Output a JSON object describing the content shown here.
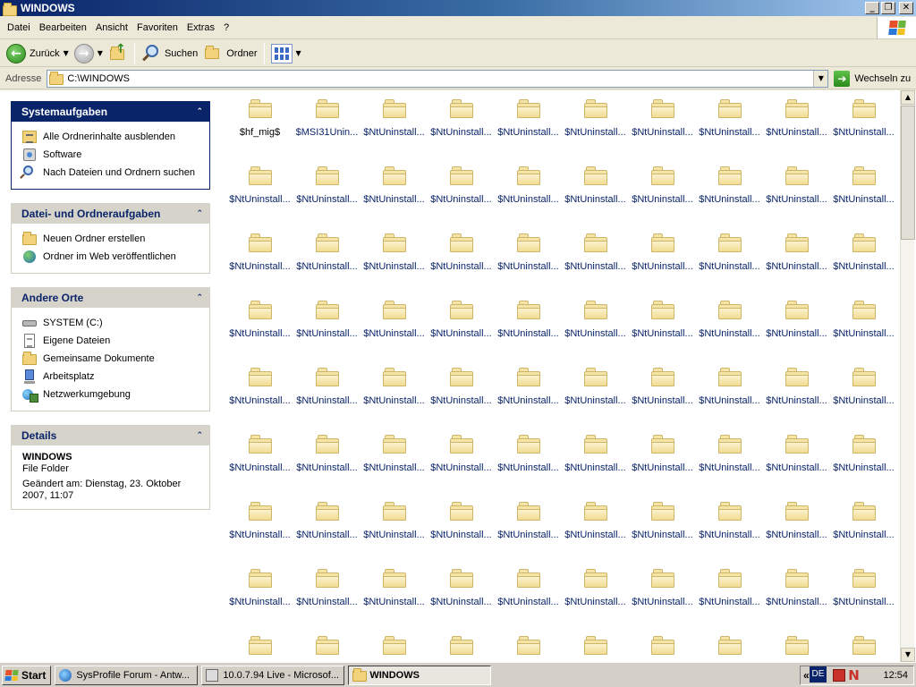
{
  "window": {
    "title": "WINDOWS",
    "controls": {
      "minimize": "_",
      "maximize": "❐",
      "close": "✕"
    }
  },
  "menu": [
    "Datei",
    "Bearbeiten",
    "Ansicht",
    "Favoriten",
    "Extras",
    "?"
  ],
  "toolbar": {
    "back_label": "Zurück",
    "search_label": "Suchen",
    "folders_label": "Ordner"
  },
  "address": {
    "label": "Adresse",
    "value": "C:\\WINDOWS",
    "go_label": "Wechseln zu"
  },
  "taskpane": {
    "system_tasks": {
      "title": "Systemaufgaben",
      "items": [
        "Alle Ordnerinhalte ausblenden",
        "Software",
        "Nach Dateien und Ordnern suchen"
      ]
    },
    "file_tasks": {
      "title": "Datei- und Ordneraufgaben",
      "items": [
        "Neuen Ordner erstellen",
        "Ordner im Web veröffentlichen"
      ]
    },
    "other_places": {
      "title": "Andere Orte",
      "items": [
        "SYSTEM (C:)",
        "Eigene Dateien",
        "Gemeinsame Dokumente",
        "Arbeitsplatz",
        "Netzwerkumgebung"
      ]
    },
    "details": {
      "title": "Details",
      "name": "WINDOWS",
      "type": "File Folder",
      "modified": "Geändert am: Dienstag, 23. Oktober 2007, 11:07"
    }
  },
  "files": {
    "first": [
      "$hf_mig$",
      "$MSI31Unin..."
    ],
    "repeated_name": "$NtUninstall...",
    "repeated_count": 78,
    "partial_row_count": 10
  },
  "taskbar": {
    "start_label": "Start",
    "tasks": [
      "SysProfile Forum - Antw...",
      "10.0.7.94 Live - Microsof...",
      "WINDOWS"
    ],
    "lang": "DE",
    "tray_chevron": "«",
    "clock": "12:54"
  },
  "icons": {
    "title": "folder-icon",
    "back": "back-arrow-icon",
    "forward": "forward-arrow-icon",
    "up": "folder-up-icon",
    "search": "search-icon",
    "folders": "folders-icon",
    "views": "views-icon",
    "go": "go-arrow-icon"
  },
  "colors": {
    "titlebar": "#0a246a",
    "link": "#0a246a",
    "folder": "#f4e4a6",
    "panel_header": "#d6d3ca"
  }
}
